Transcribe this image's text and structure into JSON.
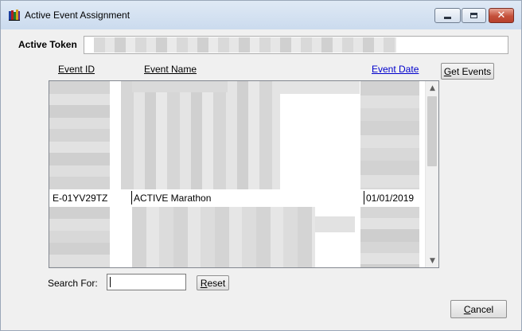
{
  "window": {
    "title": "Active Event Assignment"
  },
  "token": {
    "label": "Active Token",
    "value": ""
  },
  "table": {
    "columns": [
      "Event ID",
      "Event Name",
      "Event Date"
    ],
    "visible_row": {
      "event_id": "E-01YV29TZ",
      "event_name": "ACTIVE Marathon",
      "event_date": "01/01/2019"
    }
  },
  "buttons": {
    "get_events_u": "G",
    "get_events_rest": "et Events",
    "reset_u": "R",
    "reset_rest": "eset",
    "cancel_u": "C",
    "cancel_rest": "ancel"
  },
  "search": {
    "label": "Search For:",
    "value": ""
  },
  "colors": {
    "titlebar": "#cbdbee",
    "close_button": "#c4503a",
    "link_blue": "#0000cc",
    "blur_gray": "#d4d4d4"
  },
  "icons": {
    "app": "books-icon",
    "minimize": "minimize-icon",
    "maximize": "maximize-icon",
    "close": "close-icon",
    "scroll_up": "chevron-up-icon",
    "scroll_down": "chevron-down-icon"
  }
}
